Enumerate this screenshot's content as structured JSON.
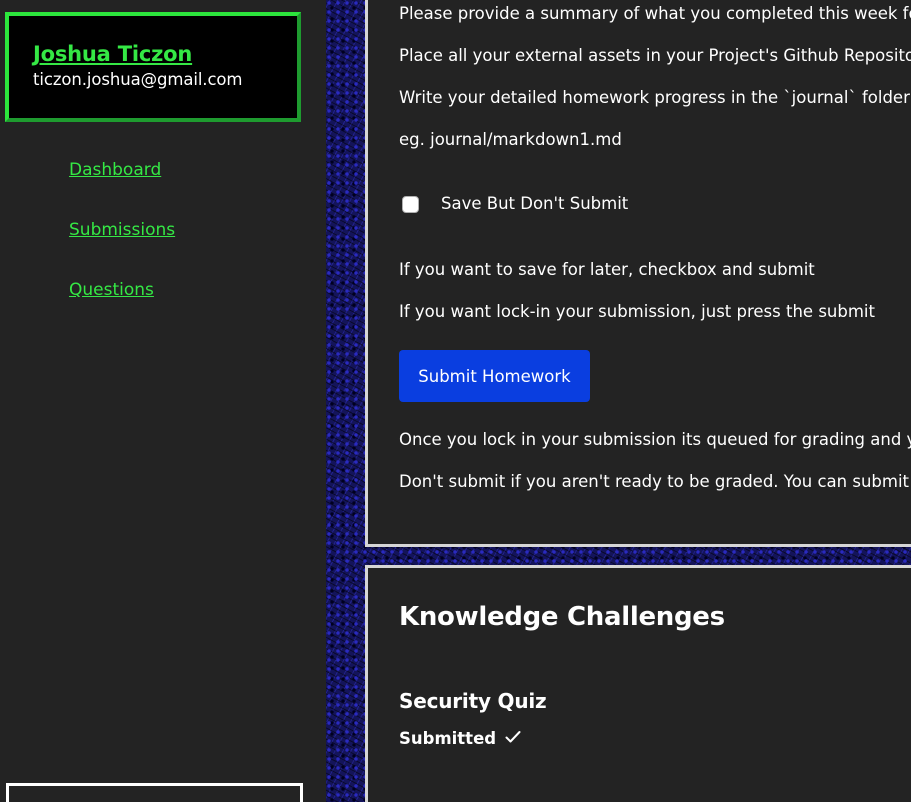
{
  "sidebar": {
    "profile": {
      "name": "Joshua Ticzon",
      "email": "ticzon.joshua@gmail.com"
    },
    "nav": [
      {
        "label": "Dashboard"
      },
      {
        "label": "Submissions"
      },
      {
        "label": "Questions"
      }
    ]
  },
  "homework": {
    "instructions": [
      "Please provide a summary of what you completed this week for",
      "Place all your external assets in your Project's Github Repository",
      "Write your detailed homework progress in the `journal` folder in",
      "eg. journal/markdown1.md"
    ],
    "save_checkbox_label": "Save But Don't Submit",
    "save_checkbox_checked": false,
    "save_hint": "If you want to save for later, checkbox and submit",
    "lock_hint": "If you want lock-in your submission, just press the submit",
    "submit_label": "Submit Homework",
    "queued_note": "Once you lock in your submission its queued for grading and you",
    "ready_note": "Don't submit if you aren't ready to be graded. You can submit lat"
  },
  "knowledge": {
    "title": "Knowledge Challenges",
    "quiz": {
      "title": "Security Quiz",
      "status": "Submitted",
      "status_icon": "check-icon"
    }
  },
  "colors": {
    "sidebar_bg": "#232323",
    "accent_green": "#35e845",
    "button_blue": "#0a3ee0",
    "texture_blue": "#14145a"
  }
}
